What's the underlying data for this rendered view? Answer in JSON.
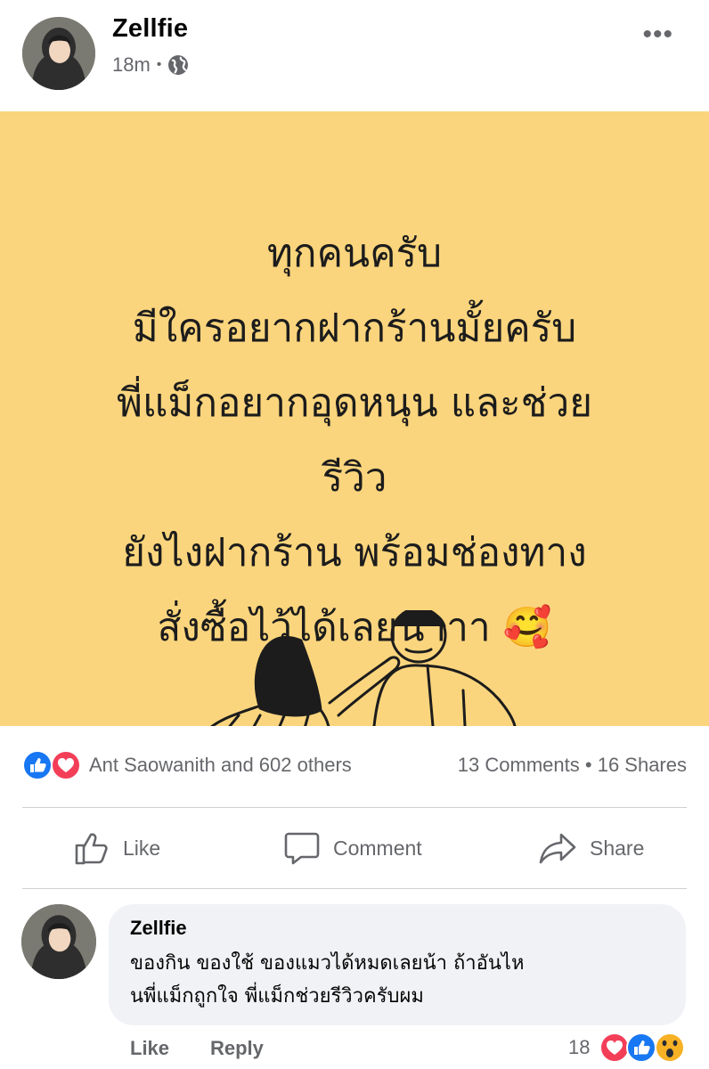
{
  "post": {
    "author": "Zellfie",
    "time": "18m",
    "separator": "•",
    "more": "•••",
    "background_color": "#fbd57d",
    "text": "ทุกคนครับ\nมีใครอยากฝากร้านมั้ยครับ\nพี่แม็กอยากอุดหนุน และช่วย\nรีวิว\nยังไงฝากร้าน พร้อมช่องทาง\nสั่งซื้อไว้ได้เลยนาาา 🥰"
  },
  "reactions": {
    "names": "Ant Saowanith and 602 others",
    "comments": "13 Comments",
    "dot": "•",
    "shares": "16 Shares",
    "icons": [
      "like-icon",
      "love-icon"
    ]
  },
  "actions": {
    "like": "Like",
    "comment": "Comment",
    "share": "Share"
  },
  "comment": {
    "author": "Zellfie",
    "text": "ของกิน ของใช้ ของแมวได้หมดเลยน้า ถ้าอันไห\nนพี่แม็กถูกใจ พี่แม็กช่วยรีวิวครับผม",
    "like": "Like",
    "reply": "Reply",
    "reaction_count": "18",
    "reaction_icons": [
      "love-icon",
      "like-icon",
      "wow-icon"
    ]
  },
  "colors": {
    "like_blue": "#1877f2",
    "love_red": "#f33e58",
    "wow_yellow": "#f7b125",
    "meta_gray": "#65676b"
  }
}
